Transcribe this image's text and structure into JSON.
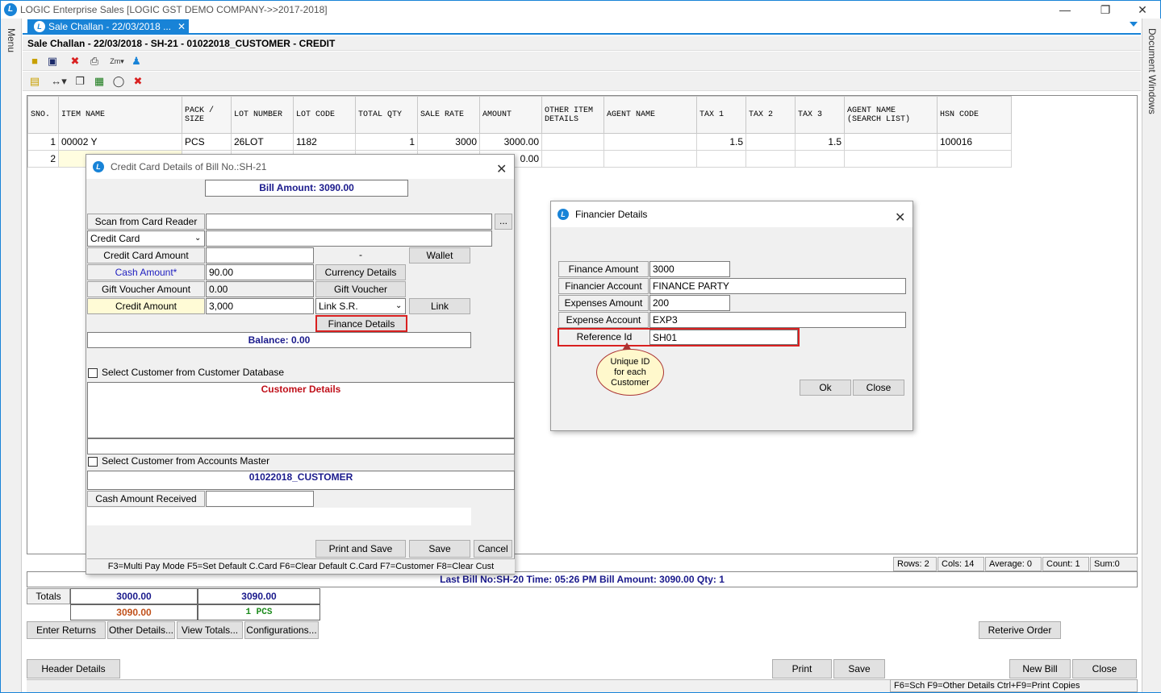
{
  "window": {
    "title": "LOGIC Enterprise Sales  [LOGIC GST DEMO COMPANY->>2017-2018]"
  },
  "side": {
    "left": "Menu",
    "right": "Document Windows"
  },
  "tab": {
    "label": "Sale Challan - 22/03/2018 ..."
  },
  "caption": "Sale Challan - 22/03/2018 - SH-21 - 01022018_CUSTOMER - CREDIT",
  "grid": {
    "headers": [
      "SNO.",
      "ITEM NAME",
      "PACK / SIZE",
      "LOT NUMBER",
      "LOT CODE",
      "TOTAL QTY",
      "SALE RATE",
      "AMOUNT",
      "OTHER ITEM DETAILS",
      "AGENT NAME",
      "TAX 1",
      "TAX 2",
      "TAX 3",
      "AGENT NAME (SEARCH LIST)",
      "HSN CODE"
    ],
    "rows": [
      [
        "1",
        "00002 Y",
        "PCS",
        "26LOT",
        "1182",
        "1",
        "3000",
        "3000.00",
        "",
        "",
        "1.5",
        "",
        "1.5",
        "",
        "100016"
      ],
      [
        "2",
        "",
        "",
        "",
        "",
        "",
        "",
        "0.00",
        "",
        "",
        "",
        "",
        "",
        "",
        ""
      ]
    ]
  },
  "credit": {
    "title": "Credit Card Details of Bill No.:SH-21",
    "bill_amount": "Bill Amount: 3090.00",
    "scan_label": "Scan from Card Reader",
    "browse": "...",
    "card_type": "Credit Card",
    "cc_amount_label": "Credit Card Amount",
    "dash": "-",
    "wallet": "Wallet",
    "cash_label": "Cash Amount*",
    "cash_value": "90.00",
    "currency_btn": "Currency Details",
    "gift_label": "Gift Voucher Amount",
    "gift_value": "0.00",
    "gift_btn": "Gift Voucher",
    "credit_label": "Credit Amount",
    "credit_value": "3,000",
    "link_sr": "Link S.R.",
    "link_btn": "Link",
    "finance_btn": "Finance Details",
    "balance": "Balance: 0.00",
    "select_db": "Select Customer from Customer Database",
    "customer_details": "Customer Details",
    "select_acc": "Select Customer from Accounts Master",
    "customer_name": "01022018_CUSTOMER",
    "cash_received_label": "Cash Amount Received",
    "print_save": "Print and Save",
    "save": "Save",
    "cancel": "Cancel",
    "hint": "F3=Multi Pay Mode  F5=Set Default C.Card   F6=Clear Default C.Card   F7=Customer F8=Clear Cust"
  },
  "finance": {
    "title": "Financier Details",
    "finance_amount_label": "Finance Amount",
    "finance_amount": "3000",
    "financier_account_label": "Financier Account",
    "financier_account": "FINANCE PARTY",
    "expenses_amount_label": "Expenses Amount",
    "expenses_amount": "200",
    "expense_account_label": "Expense Account",
    "expense_account": "EXP3",
    "reference_label": "Reference Id",
    "reference": "SH01",
    "ok": "Ok",
    "close": "Close",
    "callout_l1": "Unique ID",
    "callout_l2": "for each",
    "callout_l3": "Customer"
  },
  "status": {
    "rows": "Rows: 2",
    "cols": "Cols: 14",
    "average": "Average: 0",
    "count": "Count: 1",
    "sum": "Sum:0",
    "last_bill": "Last Bill No:SH-20   Time: 05:26 PM     Bill Amount:  3090.00     Qty:  1"
  },
  "totals": {
    "label": "Totals",
    "v1": "3000.00",
    "v2": "3090.00",
    "v3": "3090.00",
    "v4": "1 PCS"
  },
  "buttons": {
    "enter_returns": "Enter Returns",
    "other_details": "Other Details...",
    "view_totals": "View Totals...",
    "configurations": "Configurations...",
    "retrieve_order": "Reterive Order",
    "header_details": "Header Details",
    "print": "Print",
    "save": "Save",
    "new_bill": "New Bill",
    "close": "Close"
  },
  "footer_hint": "F6=Sch  F9=Other Details  Ctrl+F9=Print Copies",
  "colors": {
    "accent": "#1883d7",
    "navy": "#1a1a8c",
    "red": "#d92020",
    "brown": "#c0501a",
    "green": "#1a8a1a"
  }
}
